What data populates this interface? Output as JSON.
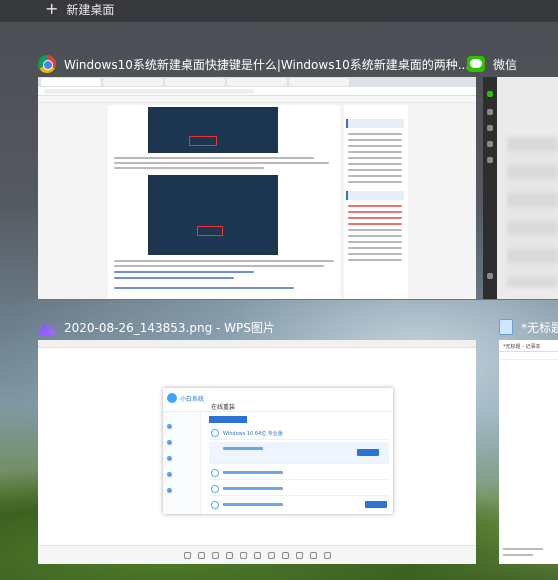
{
  "task_view": {
    "new_desktop_label": "新建桌面"
  },
  "windows": [
    {
      "id": "browser",
      "title": "Windows10系统新建桌面快捷键是什么|Windows10系统新建桌面的两种...",
      "icon": "chrome-icon"
    },
    {
      "id": "wechat",
      "title": "微信",
      "icon": "wechat-icon"
    },
    {
      "id": "wps",
      "title": "2020-08-26_143853.png - WPS图片",
      "icon": "wps-photo-icon"
    },
    {
      "id": "notepad",
      "title": "*无标题",
      "icon": "notepad-icon"
    }
  ],
  "installer_dialog": {
    "brand": "小白系统",
    "heading": "在线重装",
    "selected_os": "Windows 10 64位 专业版"
  },
  "notepad": {
    "window_title": "*无标题 - 记事本"
  },
  "colors": {
    "accent": "#2b74d6",
    "wechat_green": "#2dc100"
  }
}
